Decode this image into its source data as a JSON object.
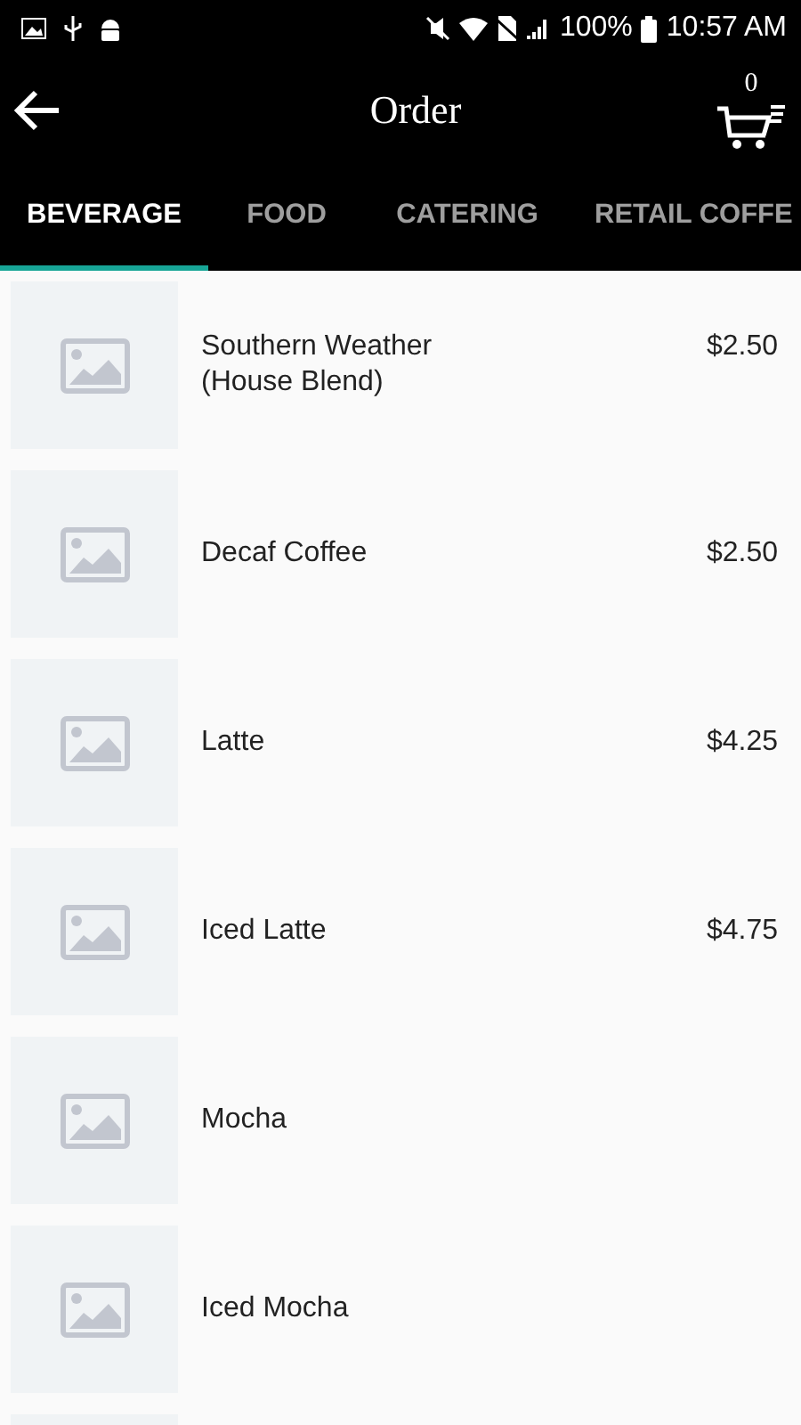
{
  "status_bar": {
    "battery": "100%",
    "time": "10:57 AM"
  },
  "header": {
    "title": "Order",
    "cart_count": "0"
  },
  "tabs": [
    {
      "label": "BEVERAGE",
      "selected": true
    },
    {
      "label": "FOOD",
      "selected": false
    },
    {
      "label": "CATERING",
      "selected": false
    },
    {
      "label": "RETAIL COFFE",
      "selected": false
    }
  ],
  "items": [
    {
      "kind": "product",
      "name": "Southern Weather\n(House Blend)",
      "price": "$2.50"
    },
    {
      "kind": "product",
      "name": "Decaf Coffee",
      "price": "$2.50"
    },
    {
      "kind": "product",
      "name": "Latte",
      "price": "$4.25"
    },
    {
      "kind": "product",
      "name": "Iced Latte",
      "price": "$4.75"
    },
    {
      "kind": "product",
      "name": "Mocha"
    },
    {
      "kind": "product",
      "name": "Iced Mocha"
    },
    {
      "kind": "cut_off"
    }
  ]
}
